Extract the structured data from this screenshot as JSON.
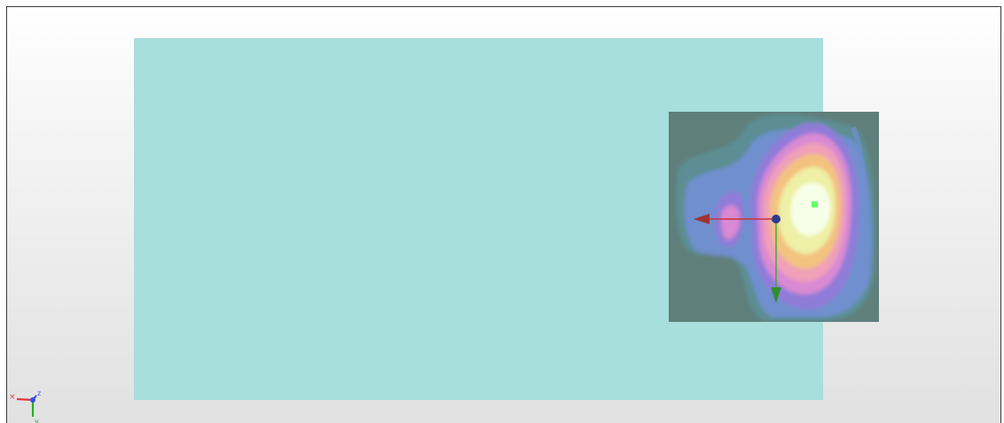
{
  "viewer": {
    "background_top": "#ffffff",
    "background_bottom": "#e1e1e1",
    "border_color": "#3a3a3a"
  },
  "plate": {
    "color": "#a8dedb"
  },
  "heatmap": {
    "colors": {
      "low": "#5f7f7b",
      "teal": "#5c8e93",
      "blue": "#6f8fce",
      "violet": "#8f7bd8",
      "pink": "#d98ad2",
      "hot": "#f0a0b7",
      "orange": "#f3c27f",
      "yellow": "#eef0a6",
      "center": "#f7ffe8"
    }
  },
  "gizmo": {
    "x_axis_color": "#cc3333",
    "y_axis_color": "#33aa33",
    "origin_color": "#2d3d8f",
    "marker_color": "#66ff66"
  },
  "triad": {
    "x_label": "×",
    "y_label": "y",
    "z_label": "z",
    "x_color": "#e03a3a",
    "y_color": "#20b020",
    "z_color": "#3050e0"
  }
}
